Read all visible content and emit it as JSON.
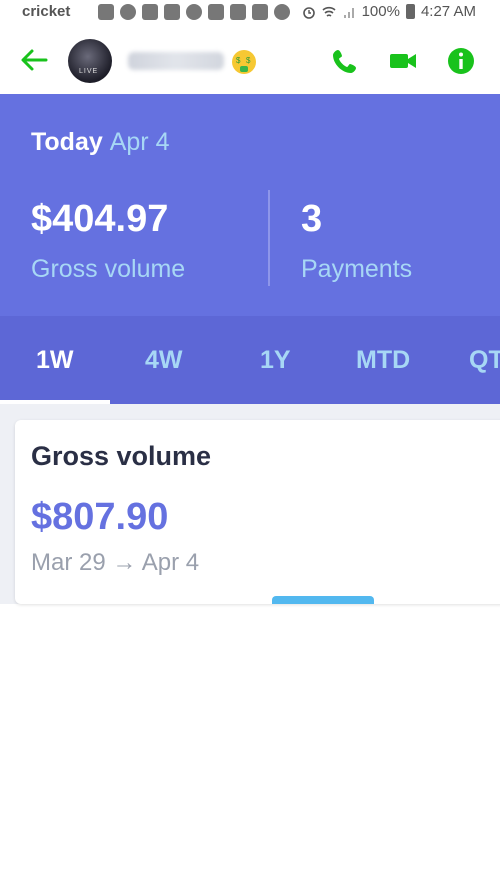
{
  "status_bar": {
    "carrier": "cricket",
    "battery": "100%",
    "time": "4:27 AM"
  },
  "chat_header": {
    "contact_name": "",
    "avatar_text": "LIVE",
    "accent_color": "#19c21c"
  },
  "summary": {
    "today_label": "Today",
    "today_date": "Apr 4",
    "gross_volume_value": "$404.97",
    "gross_volume_label": "Gross volume",
    "payments_value": "3",
    "payments_label": "Payments",
    "bg_color": "#6571e0"
  },
  "tabs": [
    {
      "label": "1W",
      "active": true
    },
    {
      "label": "4W",
      "active": false
    },
    {
      "label": "1Y",
      "active": false
    },
    {
      "label": "MTD",
      "active": false
    },
    {
      "label": "QT",
      "active": false
    }
  ],
  "card": {
    "title": "Gross volume",
    "amount": "$807.90",
    "date_range": "Mar 29 → Apr 4"
  }
}
